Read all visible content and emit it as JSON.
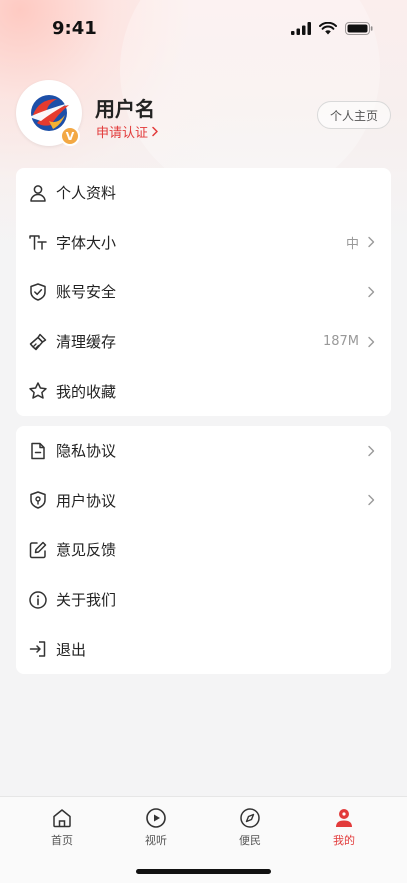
{
  "status": {
    "time": "9:41"
  },
  "profile": {
    "username": "用户名",
    "verify_label": "申请认证",
    "badge": "V",
    "homepage_button": "个人主页"
  },
  "menu1": {
    "items": [
      {
        "label": "个人资料",
        "icon": "user-icon",
        "value": ""
      },
      {
        "label": "字体大小",
        "icon": "font-size-icon",
        "value": "中"
      },
      {
        "label": "账号安全",
        "icon": "shield-check-icon",
        "value": ""
      },
      {
        "label": "清理缓存",
        "icon": "broom-icon",
        "value": "187M"
      },
      {
        "label": "我的收藏",
        "icon": "star-icon",
        "value": ""
      }
    ]
  },
  "menu2": {
    "items": [
      {
        "label": "隐私协议",
        "icon": "document-icon"
      },
      {
        "label": "用户协议",
        "icon": "shield-location-icon"
      },
      {
        "label": "意见反馈",
        "icon": "edit-icon"
      },
      {
        "label": "关于我们",
        "icon": "info-icon"
      },
      {
        "label": "退出",
        "icon": "logout-icon"
      }
    ]
  },
  "tabbar": {
    "tabs": [
      {
        "label": "首页",
        "icon": "home-icon"
      },
      {
        "label": "视听",
        "icon": "play-icon"
      },
      {
        "label": "便民",
        "icon": "compass-icon"
      },
      {
        "label": "我的",
        "icon": "person-icon",
        "active": true
      }
    ]
  },
  "colors": {
    "accent": "#e23b3b",
    "badge": "#f3a844",
    "background": "#f4f4f5"
  }
}
